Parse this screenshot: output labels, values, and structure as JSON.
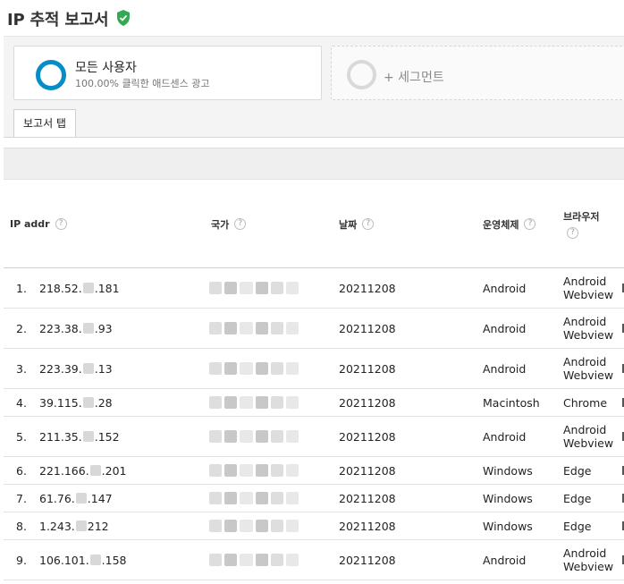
{
  "header": {
    "title": "IP 추적 보고서"
  },
  "segments": {
    "primary": {
      "name": "모든 사용자",
      "subtitle": "100.00% 클릭한 애드센스 광고"
    },
    "add_label": "+ 세그먼트"
  },
  "tabs": [
    {
      "label": "보고서 탭"
    }
  ],
  "table": {
    "columns": [
      {
        "label": "IP addr",
        "help": "?"
      },
      {
        "label": "국가",
        "help": "?"
      },
      {
        "label": "날짜",
        "help": "?"
      },
      {
        "label": "운영체제",
        "help": "?"
      },
      {
        "label": "브라우저",
        "help": "?"
      }
    ],
    "rows": [
      {
        "num": "1.",
        "ip_start": "218.52.",
        "ip_end": ".181",
        "date": "20211208",
        "os": "Android",
        "browser": "Android Webview"
      },
      {
        "num": "2.",
        "ip_start": "223.38.",
        "ip_end": ".93",
        "date": "20211208",
        "os": "Android",
        "browser": "Android Webview"
      },
      {
        "num": "3.",
        "ip_start": "223.39.",
        "ip_end": ".13",
        "date": "20211208",
        "os": "Android",
        "browser": "Android Webview"
      },
      {
        "num": "4.",
        "ip_start": "39.115.",
        "ip_end": ".28",
        "date": "20211208",
        "os": "Macintosh",
        "browser": "Chrome"
      },
      {
        "num": "5.",
        "ip_start": "211.35.",
        "ip_end": ".152",
        "date": "20211208",
        "os": "Android",
        "browser": "Android Webview"
      },
      {
        "num": "6.",
        "ip_start": "221.166.",
        "ip_end": ".201",
        "date": "20211208",
        "os": "Windows",
        "browser": "Edge"
      },
      {
        "num": "7.",
        "ip_start": "61.76.",
        "ip_end": ".147",
        "date": "20211208",
        "os": "Windows",
        "browser": "Edge"
      },
      {
        "num": "8.",
        "ip_start": "1.243.",
        "ip_end": "212",
        "date": "20211208",
        "os": "Windows",
        "browser": "Edge"
      },
      {
        "num": "9.",
        "ip_start": "106.101.",
        "ip_end": ".158",
        "date": "20211208",
        "os": "Android",
        "browser": "Android Webview"
      }
    ]
  },
  "colors": {
    "accent": "#058dc7",
    "verified": "#34a853"
  }
}
